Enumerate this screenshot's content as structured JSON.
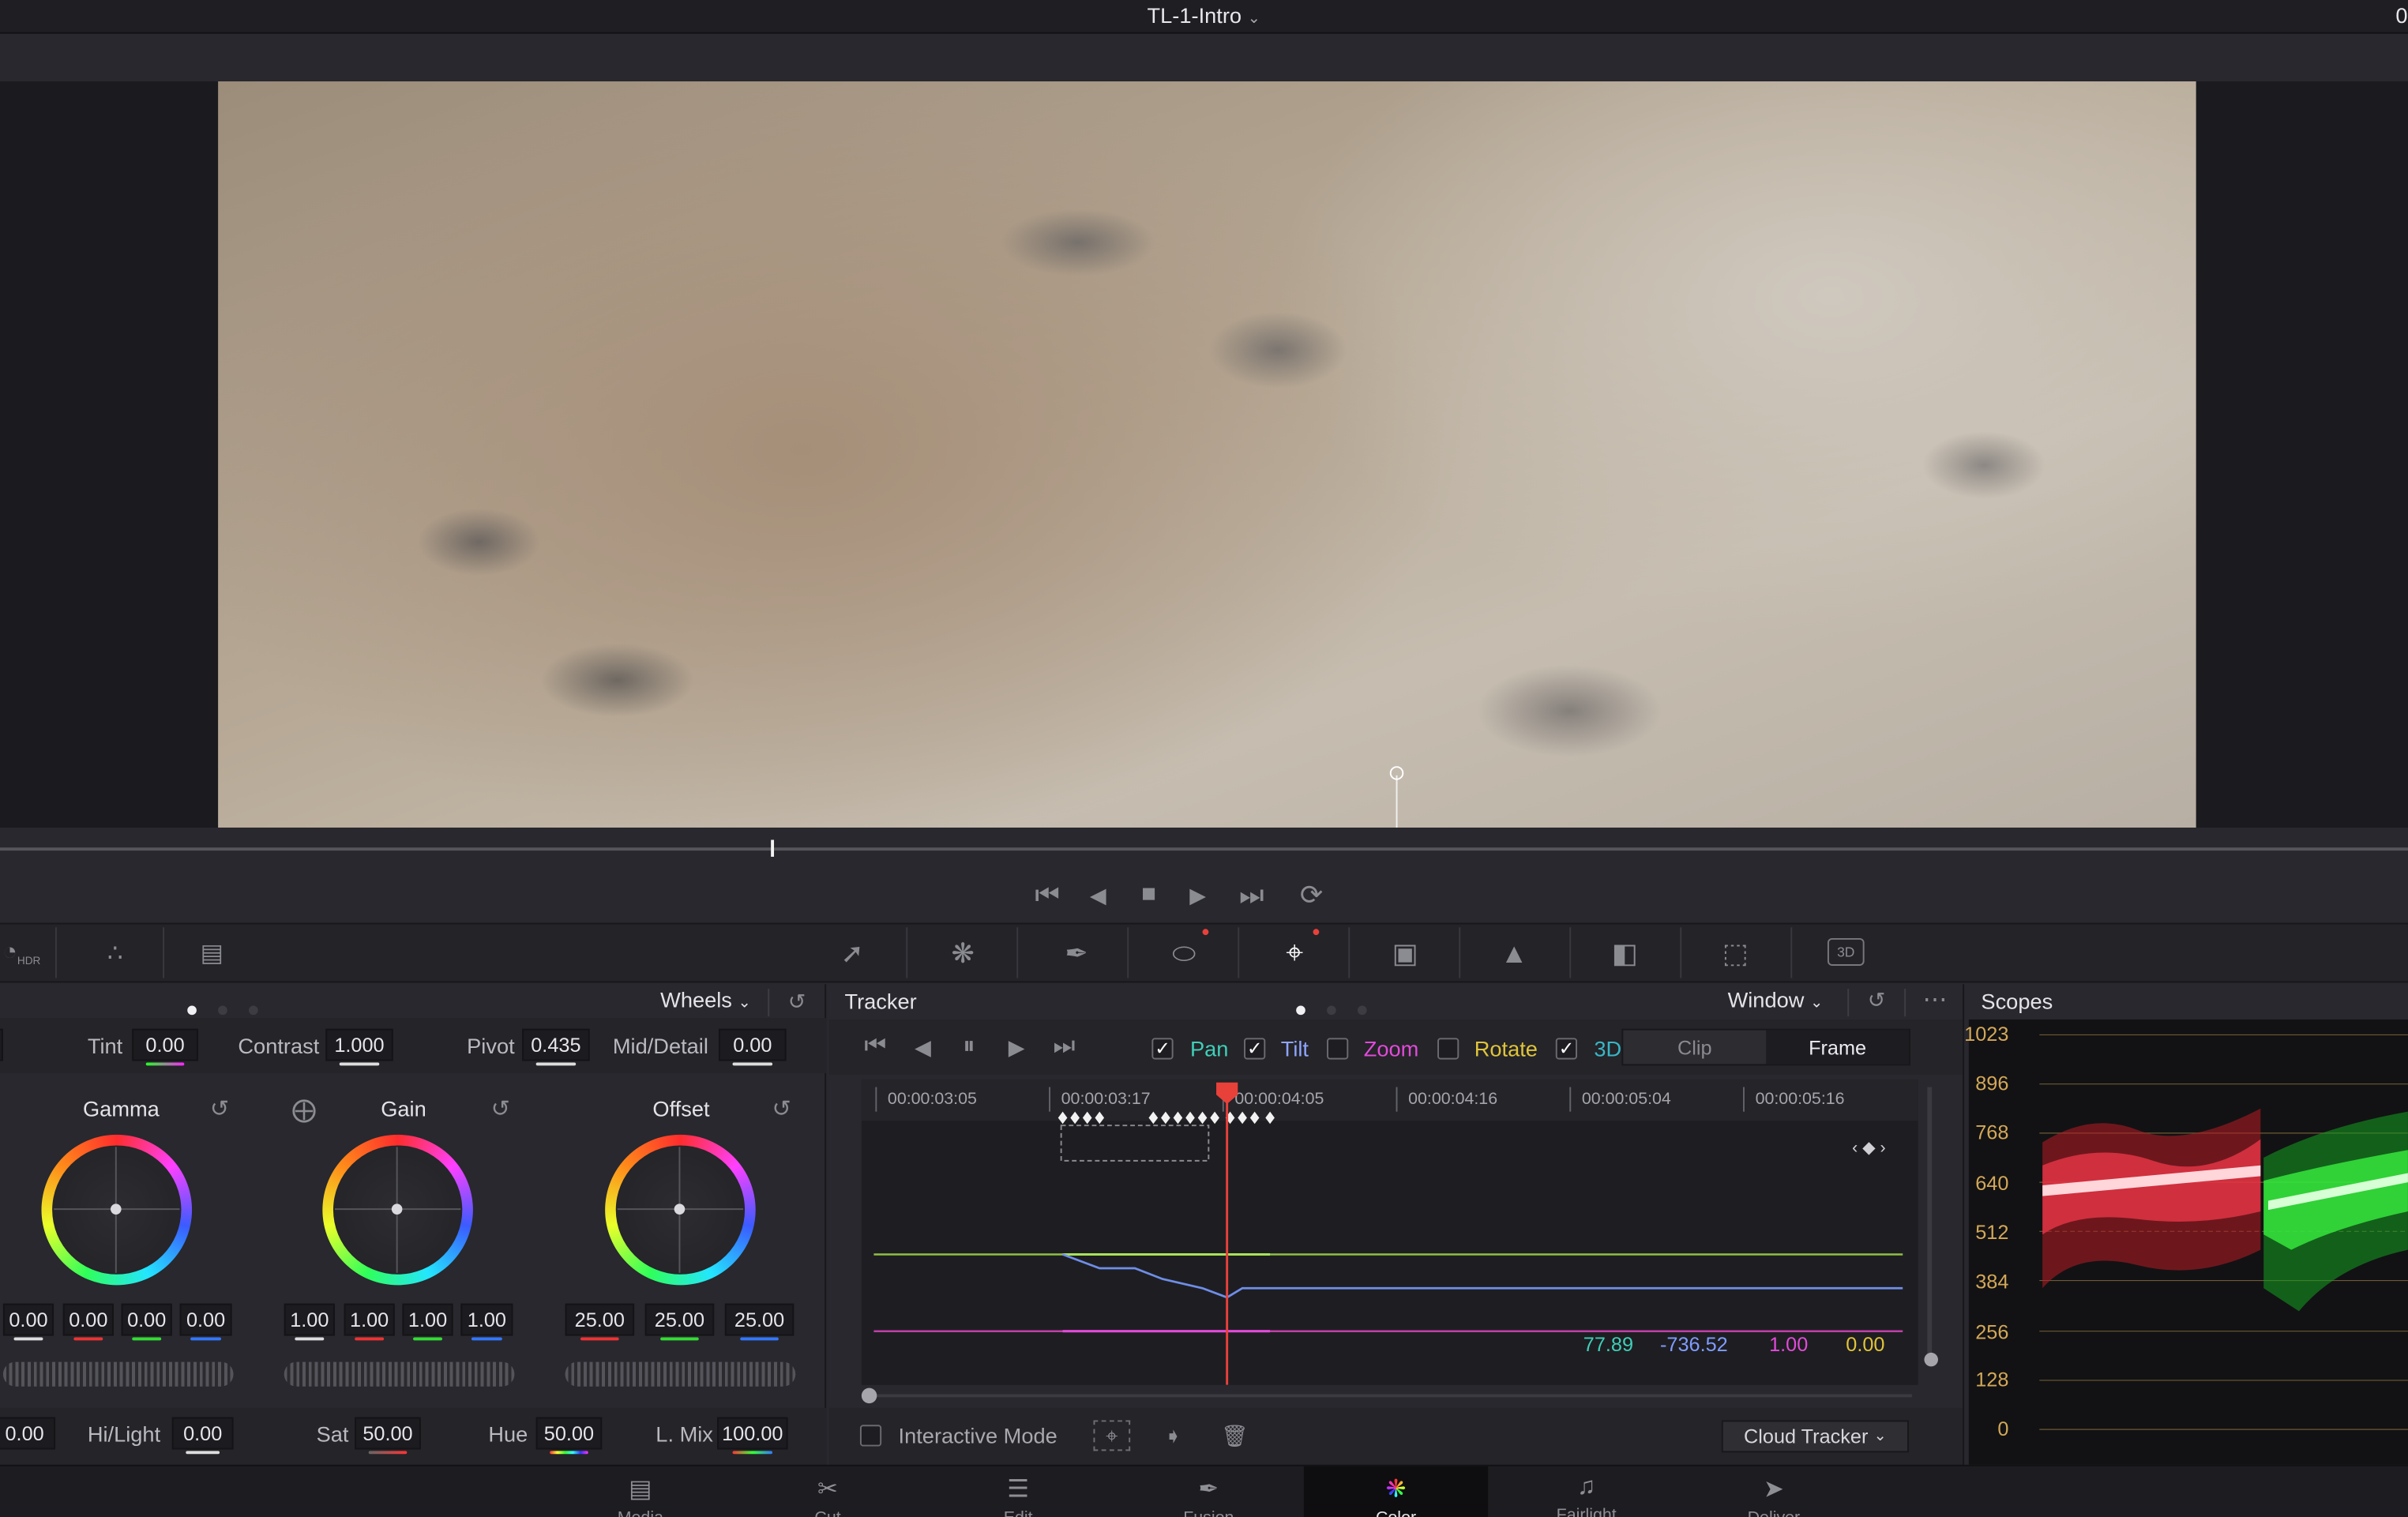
{
  "titlebar": {
    "title": "TL-1-Intro",
    "right_fragment": "0"
  },
  "viewer": {
    "image_desc": "aerial-desert-terrain",
    "scrub_fraction": 0.32
  },
  "transport": {
    "icons": [
      "go-to-start-icon",
      "play-reverse-icon",
      "stop-icon",
      "play-icon",
      "go-to-end-icon",
      "loop-icon"
    ]
  },
  "palette_toolbar": {
    "left_icons": [
      "hdr-wheels-icon",
      "rgb-mixer-icon",
      "motion-effects-icon"
    ],
    "left_badge": "HDR",
    "right_icons": [
      "curves-icon",
      "color-warper-icon",
      "qualifier-icon",
      "window-icon",
      "tracker-icon",
      "magic-mask-icon",
      "blur-icon",
      "key-icon",
      "sizing-icon",
      "3d-icon"
    ],
    "badge_3d": "3D"
  },
  "wheels_panel": {
    "mode": "Wheels",
    "top_params": [
      {
        "label": "Tint",
        "value": "0.00"
      },
      {
        "label": "Contrast",
        "value": "1.000"
      },
      {
        "label": "Pivot",
        "value": "0.435"
      },
      {
        "label": "Mid/Detail",
        "value": "0.00"
      }
    ],
    "wheels": [
      {
        "name": "Gamma",
        "values": [
          "0.00",
          "0.00",
          "0.00",
          "0.00"
        ]
      },
      {
        "name": "Gain",
        "values": [
          "1.00",
          "1.00",
          "1.00",
          "1.00"
        ]
      },
      {
        "name": "Offset",
        "values": [
          "25.00",
          "25.00",
          "25.00"
        ]
      }
    ],
    "bottom_params": [
      {
        "label": "",
        "value": "0.00"
      },
      {
        "label": "Hi/Light",
        "value": "0.00"
      },
      {
        "label": "Sat",
        "value": "50.00"
      },
      {
        "label": "Hue",
        "value": "50.00"
      },
      {
        "label": "L. Mix",
        "value": "100.00"
      }
    ]
  },
  "tracker_panel": {
    "title": "Tracker",
    "mode": "Window",
    "controls": [
      "track-reverse-icon",
      "step-back-icon",
      "pause-icon",
      "play-forward-icon",
      "track-forward-icon"
    ],
    "options": [
      {
        "label": "Pan",
        "checked": true,
        "color": "#3fcfb8"
      },
      {
        "label": "Tilt",
        "checked": true,
        "color": "#8fa5ff"
      },
      {
        "label": "Zoom",
        "checked": false,
        "color": "#e24ad9"
      },
      {
        "label": "Rotate",
        "checked": false,
        "color": "#e0c43a"
      },
      {
        "label": "3D",
        "checked": true,
        "color": "#39b6c6"
      }
    ],
    "segments": [
      "Clip",
      "Frame"
    ],
    "selected_segment": "Frame",
    "timecodes": [
      "00:00:03:05",
      "00:00:03:17",
      "00:00:04:05",
      "00:00:04:16",
      "00:00:05:04",
      "00:00:05:16"
    ],
    "readouts": [
      {
        "value": "77.89",
        "color": "#3fcfb8"
      },
      {
        "value": "-736.52",
        "color": "#7f9cff"
      },
      {
        "value": "1.00",
        "color": "#e24ad9"
      },
      {
        "value": "0.00",
        "color": "#e0c43a"
      }
    ],
    "interactive_mode": "Interactive Mode",
    "tracker_type": "Cloud Tracker"
  },
  "scopes_panel": {
    "title": "Scopes",
    "scale": [
      "1023",
      "896",
      "768",
      "640",
      "512",
      "384",
      "256",
      "128",
      "0"
    ]
  },
  "page_tabs": [
    {
      "icon": "media-page-icon",
      "label": "Media"
    },
    {
      "icon": "cut-page-icon",
      "label": "Cut"
    },
    {
      "icon": "edit-page-icon",
      "label": "Edit"
    },
    {
      "icon": "fusion-page-icon",
      "label": "Fusion"
    },
    {
      "icon": "color-page-icon",
      "label": "Color"
    },
    {
      "icon": "fairlight-page-icon",
      "label": "Fairlight"
    },
    {
      "icon": "deliver-page-icon",
      "label": "Deliver"
    }
  ],
  "active_page": "Color"
}
